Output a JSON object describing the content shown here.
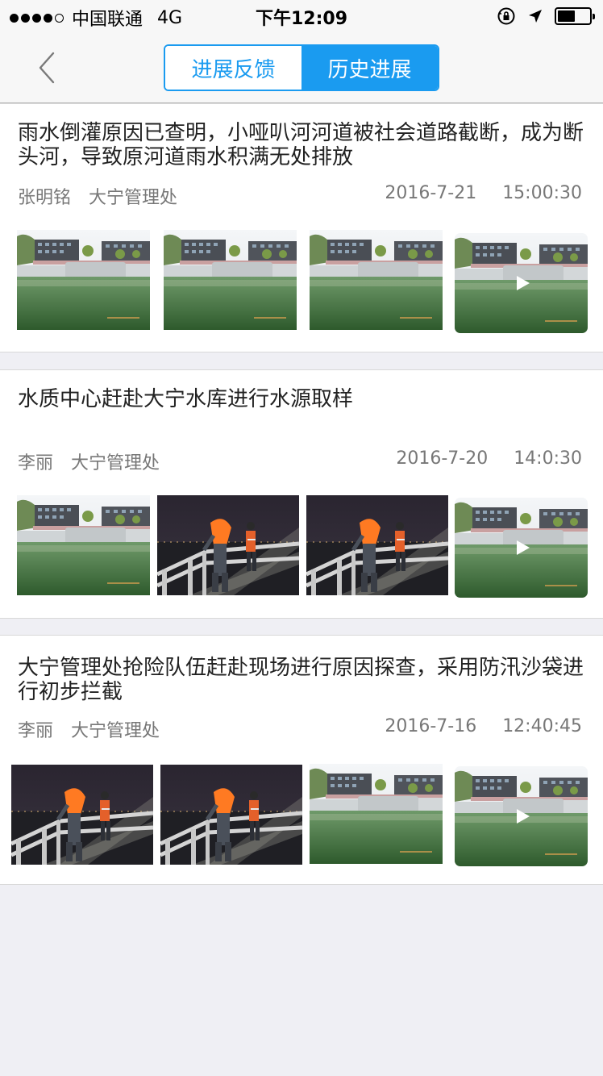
{
  "status_bar": {
    "carrier": "中国联通",
    "network": "4G",
    "time": "下午12:09",
    "signal_bars": 4,
    "battery_level": 0.55
  },
  "nav": {
    "back_icon": "chevron-left-icon",
    "tabs": [
      {
        "label": "进展反馈",
        "active": false
      },
      {
        "label": "历史进展",
        "active": true
      }
    ]
  },
  "items": [
    {
      "title": "雨水倒灌原因已查明，小哑叭河河道被社会道路截断，成为断头河，导致原河道雨水积满无处排放",
      "person": "张明铭",
      "org": "大宁管理处",
      "date": "2016-7-21",
      "time": "15:00:30",
      "media": [
        "photo-reservoir",
        "photo-reservoir",
        "photo-reservoir",
        "video-reservoir"
      ]
    },
    {
      "title": "水质中心赶赴大宁水库进行水源取样",
      "person": "李丽",
      "org": "大宁管理处",
      "date": "2016-7-20",
      "time": "14:0:30",
      "media": [
        "photo-reservoir",
        "photo-night-sampling",
        "photo-night-sampling",
        "video-reservoir"
      ]
    },
    {
      "title": "大宁管理处抢险队伍赶赴现场进行原因探查，采用防汛沙袋进行初步拦截",
      "person": "李丽",
      "org": "大宁管理处",
      "date": "2016-7-16",
      "time": "12:40:45",
      "media": [
        "photo-night-sampling",
        "photo-night-sampling",
        "photo-reservoir",
        "video-reservoir"
      ]
    }
  ],
  "colors": {
    "accent": "#1a9bf0",
    "background": "#efeff4",
    "meta_text": "#777777"
  }
}
